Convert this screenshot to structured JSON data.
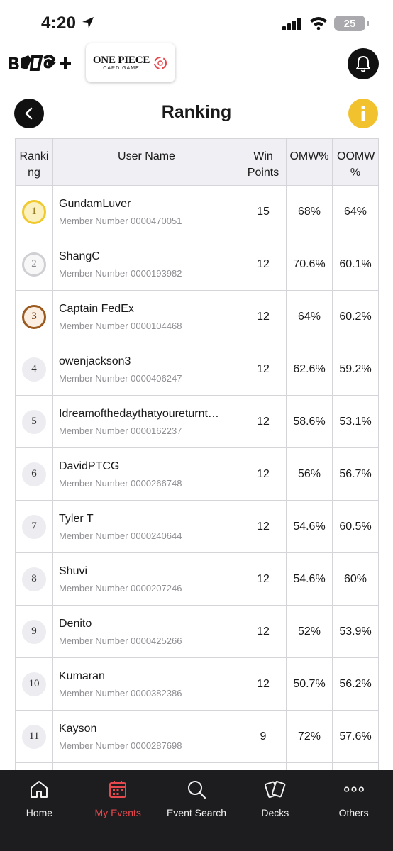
{
  "status_bar": {
    "time": "4:20",
    "battery": "25"
  },
  "header": {
    "brand": "B CG+",
    "game_logo_title": "ONE PIECE",
    "game_logo_subtitle": "CARD GAME"
  },
  "page": {
    "title": "Ranking"
  },
  "table": {
    "headers": {
      "rank": "Ranki ng",
      "user": "User Name",
      "win": "Win Points",
      "omw": "OMW%",
      "oomw": "OOMW %"
    },
    "member_prefix": "Member Number",
    "rows": [
      {
        "rank": "1",
        "name": "GundamLuver",
        "member": "Member Number 0000470051",
        "win": "15",
        "omw": "68%",
        "oomw": "64%"
      },
      {
        "rank": "2",
        "name": "ShangC",
        "member": "Member Number 0000193982",
        "win": "12",
        "omw": "70.6%",
        "oomw": "60.1%"
      },
      {
        "rank": "3",
        "name": "Captain FedEx",
        "member": "Member Number 0000104468",
        "win": "12",
        "omw": "64%",
        "oomw": "60.2%"
      },
      {
        "rank": "4",
        "name": "owenjackson3",
        "member": "Member Number 0000406247",
        "win": "12",
        "omw": "62.6%",
        "oomw": "59.2%"
      },
      {
        "rank": "5",
        "name": "Idreamofthedaythatyoureturnt…",
        "member": "Member Number 0000162237",
        "win": "12",
        "omw": "58.6%",
        "oomw": "53.1%"
      },
      {
        "rank": "6",
        "name": "DavidPTCG",
        "member": "Member Number 0000266748",
        "win": "12",
        "omw": "56%",
        "oomw": "56.7%"
      },
      {
        "rank": "7",
        "name": "Tyler T",
        "member": "Member Number 0000240644",
        "win": "12",
        "omw": "54.6%",
        "oomw": "60.5%"
      },
      {
        "rank": "8",
        "name": "Shuvi",
        "member": "Member Number 0000207246",
        "win": "12",
        "omw": "54.6%",
        "oomw": "60%"
      },
      {
        "rank": "9",
        "name": "Denito",
        "member": "Member Number 0000425266",
        "win": "12",
        "omw": "52%",
        "oomw": "53.9%"
      },
      {
        "rank": "10",
        "name": "Kumaran",
        "member": "Member Number 0000382386",
        "win": "12",
        "omw": "50.7%",
        "oomw": "56.2%"
      },
      {
        "rank": "11",
        "name": "Kayson",
        "member": "Member Number 0000287698",
        "win": "9",
        "omw": "72%",
        "oomw": "57.6%"
      }
    ]
  },
  "tab_bar": {
    "items": [
      {
        "label": "Home",
        "icon": "home-icon"
      },
      {
        "label": "My Events",
        "icon": "calendar-icon",
        "active": true
      },
      {
        "label": "Event Search",
        "icon": "search-icon"
      },
      {
        "label": "Decks",
        "icon": "cards-icon"
      },
      {
        "label": "Others",
        "icon": "more-icon"
      }
    ]
  },
  "colors": {
    "accent_active": "#e5484d",
    "info": "#f2c12e",
    "tab_bar_bg": "#1d1d1f",
    "header_bg": "#efeff4"
  }
}
